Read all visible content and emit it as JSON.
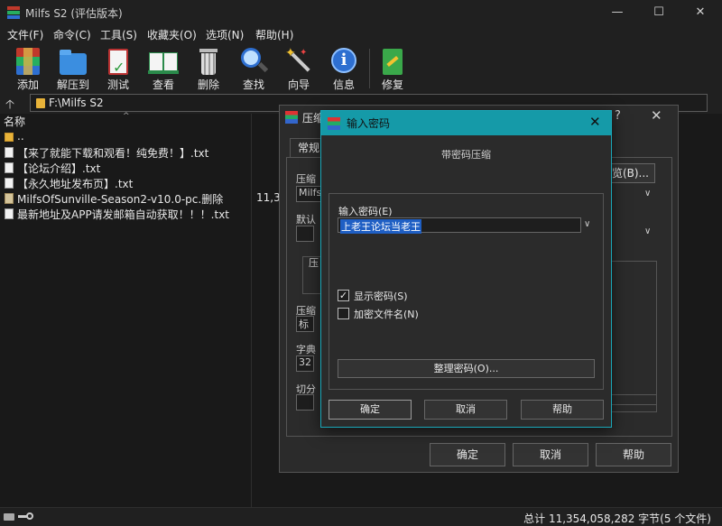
{
  "window": {
    "title": "Milfs S2 (评估版本)",
    "minimize": "—",
    "maximize": "☐",
    "close": "✕"
  },
  "menu": [
    "文件(F)",
    "命令(C)",
    "工具(S)",
    "收藏夹(O)",
    "选项(N)",
    "帮助(H)"
  ],
  "toolbar": {
    "add": "添加",
    "extract": "解压到",
    "test": "测试",
    "view": "查看",
    "delete": "删除",
    "find": "查找",
    "wizard": "向导",
    "info": "信息",
    "repair": "修复"
  },
  "address": {
    "up": "🡡",
    "path": "F:\\Milfs S2"
  },
  "filelist": {
    "col_name": "名称",
    "sort_caret": "^",
    "rows": [
      {
        "name": "..",
        "type": "folder"
      },
      {
        "name": "【来了就能下载和观看！纯免费！】.txt",
        "type": "txt"
      },
      {
        "name": "【论坛介绍】.txt",
        "type": "txt"
      },
      {
        "name": "【永久地址发布页】.txt",
        "type": "txt"
      },
      {
        "name": "MilfsOfSunville-Season2-v10.0-pc.删除",
        "type": "rar",
        "size": "11,3"
      },
      {
        "name": "最新地址及APP请发邮箱自动获取！！！.txt",
        "type": "txt"
      }
    ]
  },
  "status": {
    "text": "总计 11,354,058,282 字节(5 个文件)"
  },
  "archive_dialog": {
    "title": "压缩",
    "help_glyph": "?",
    "close": "✕",
    "tab_general": "常规",
    "lbl_archive_name": "压缩",
    "field_archive_name": "Milfs",
    "lbl_default": "默认",
    "lbl_group": "压",
    "lbl_method": "压缩",
    "field_method": "标准",
    "lbl_dict": "字典",
    "field_dict": "32",
    "lbl_split": "切分",
    "browse": "览(B)...",
    "ok": "确定",
    "cancel": "取消",
    "help": "帮助"
  },
  "password_dialog": {
    "title": "输入密码",
    "close": "✕",
    "subtitle": "带密码压缩",
    "label_password": "输入密码(E)",
    "password_value": "上老王论坛当老王",
    "show_password": "显示密码(S)",
    "show_password_checked": true,
    "encrypt_names": "加密文件名(N)",
    "encrypt_names_checked": false,
    "check_mark": "✓",
    "manage": "整理密码(O)...",
    "ok": "确定",
    "cancel": "取消",
    "help": "帮助"
  }
}
